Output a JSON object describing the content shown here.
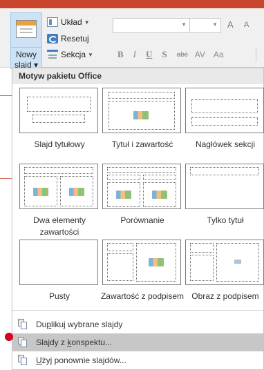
{
  "ribbon": {
    "new_slide": {
      "line1": "Nowy",
      "line2": "slajd ▾"
    },
    "layout_label": "Układ",
    "reset_label": "Resetuj",
    "section_label": "Sekcja",
    "grow_font": "A",
    "shrink_font": "A",
    "format": {
      "bold": "B",
      "italic": "I",
      "underline": "U",
      "shadow": "S",
      "strike": "abc",
      "spacing": "AV",
      "case": "Aa"
    }
  },
  "panel": {
    "header": "Motyw pakietu Office",
    "layouts": [
      {
        "name": "Slajd tytułowy"
      },
      {
        "name": "Tytuł i zawartość"
      },
      {
        "name": "Nagłówek sekcji"
      },
      {
        "name": "Dwa elementy zawartości"
      },
      {
        "name": "Porównanie"
      },
      {
        "name": "Tylko tytuł"
      },
      {
        "name": "Pusty"
      },
      {
        "name": "Zawartość z podpisem"
      },
      {
        "name": "Obraz z podpisem"
      }
    ],
    "menu": [
      {
        "pre": "Du",
        "key": "p",
        "post": "likuj wybrane slajdy"
      },
      {
        "pre": "Slajdy z ",
        "key": "k",
        "post": "onspektu..."
      },
      {
        "pre": "",
        "key": "U",
        "post": "żyj ponownie slajdów..."
      }
    ]
  },
  "colors": {
    "title_strip": "#c8452c",
    "highlight": "#c7c7c7",
    "marker": "#d8001b"
  }
}
